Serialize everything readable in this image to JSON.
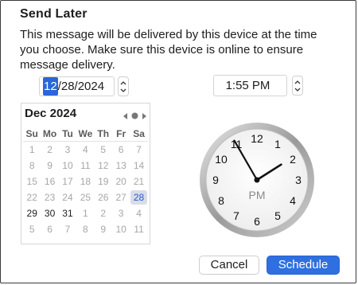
{
  "dialog": {
    "title": "Send Later",
    "description": "This message will be delivered by this device at the time you choose. Make sure this device is online to ensure message delivery."
  },
  "date_picker": {
    "month_segment": "12",
    "rest": "/28/2024"
  },
  "time_picker": {
    "value": "1:55 PM"
  },
  "calendar": {
    "month_label": "Dec 2024",
    "weekdays": [
      "Su",
      "Mo",
      "Tu",
      "We",
      "Th",
      "Fr",
      "Sa"
    ],
    "weeks": [
      [
        "1",
        "2",
        "3",
        "4",
        "5",
        "6",
        "7"
      ],
      [
        "8",
        "9",
        "10",
        "11",
        "12",
        "13",
        "14"
      ],
      [
        "15",
        "16",
        "17",
        "18",
        "19",
        "20",
        "21"
      ],
      [
        "22",
        "23",
        "24",
        "25",
        "26",
        "27",
        "28"
      ],
      [
        "29",
        "30",
        "31",
        "1",
        "2",
        "3",
        "4"
      ],
      [
        "5",
        "6",
        "7",
        "8",
        "9",
        "10",
        "11"
      ]
    ],
    "selected_day": "28"
  },
  "clock": {
    "numbers": [
      "12",
      "1",
      "2",
      "3",
      "4",
      "5",
      "6",
      "7",
      "8",
      "9",
      "10",
      "11"
    ],
    "period": "PM",
    "hour": 1,
    "minute": 55
  },
  "buttons": {
    "cancel": "Cancel",
    "schedule": "Schedule"
  },
  "colors": {
    "accent": "#2f6fe0",
    "selection": "#2a66d9"
  }
}
